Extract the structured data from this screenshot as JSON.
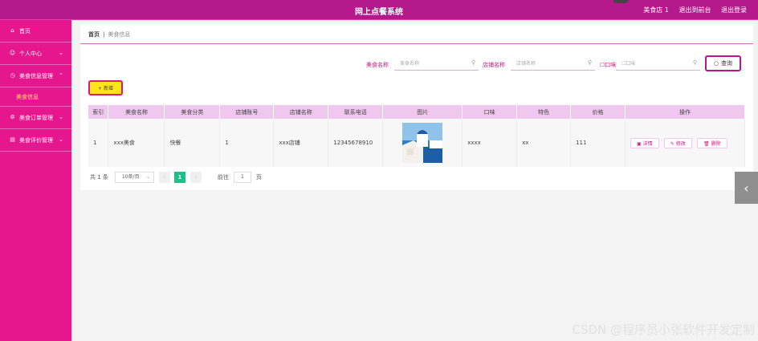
{
  "header": {
    "title": "网上点餐系统",
    "user": "美食店 1",
    "links": [
      "退出到前台",
      "退出登录"
    ]
  },
  "sidebar": {
    "items": [
      {
        "label": "首页",
        "icon": "home-icon"
      },
      {
        "label": "个人中心",
        "icon": "user-icon"
      },
      {
        "label": "美食信息管理",
        "icon": "clock-icon"
      },
      {
        "label": "美食订单管理",
        "icon": "gear-icon"
      },
      {
        "label": "美食评价管理",
        "icon": "chart-icon"
      }
    ],
    "sub_item": "美食信息"
  },
  "breadcrumb": {
    "home": "首页",
    "sep": "|",
    "current": "美食信息"
  },
  "search": {
    "food_name_label": "美食名称",
    "food_name_placeholder": "美食名称",
    "shop_name_label": "店铺名称",
    "shop_name_placeholder": "店铺名称",
    "taste_label": "口味",
    "taste_placeholder": "口味",
    "query_button": "查询"
  },
  "toolbar": {
    "add_button": "+ 新增"
  },
  "table": {
    "headers": [
      "索引",
      "美食名称",
      "美食分类",
      "店铺账号",
      "店铺名称",
      "联系电话",
      "图片",
      "口味",
      "特色",
      "价格",
      "操作"
    ],
    "row": [
      "1",
      "xxx美食",
      "快餐",
      "1",
      "xxx店铺",
      "12345678910",
      "",
      "xxxx",
      "xx",
      "111"
    ],
    "actions": [
      "详情",
      "修改",
      "删除"
    ]
  },
  "pager": {
    "total": "共 1 条",
    "page_size": "10条/页",
    "current_page": "1",
    "goto_label": "前往",
    "goto_value": "1",
    "page_unit": "页"
  },
  "watermark": "CSDN @程序员小张软件开发定制",
  "colors": {
    "accent": "#e5168e",
    "topbar": "#b5188a",
    "table_header": "#f0c7ef",
    "add_button": "#ffe51a"
  }
}
